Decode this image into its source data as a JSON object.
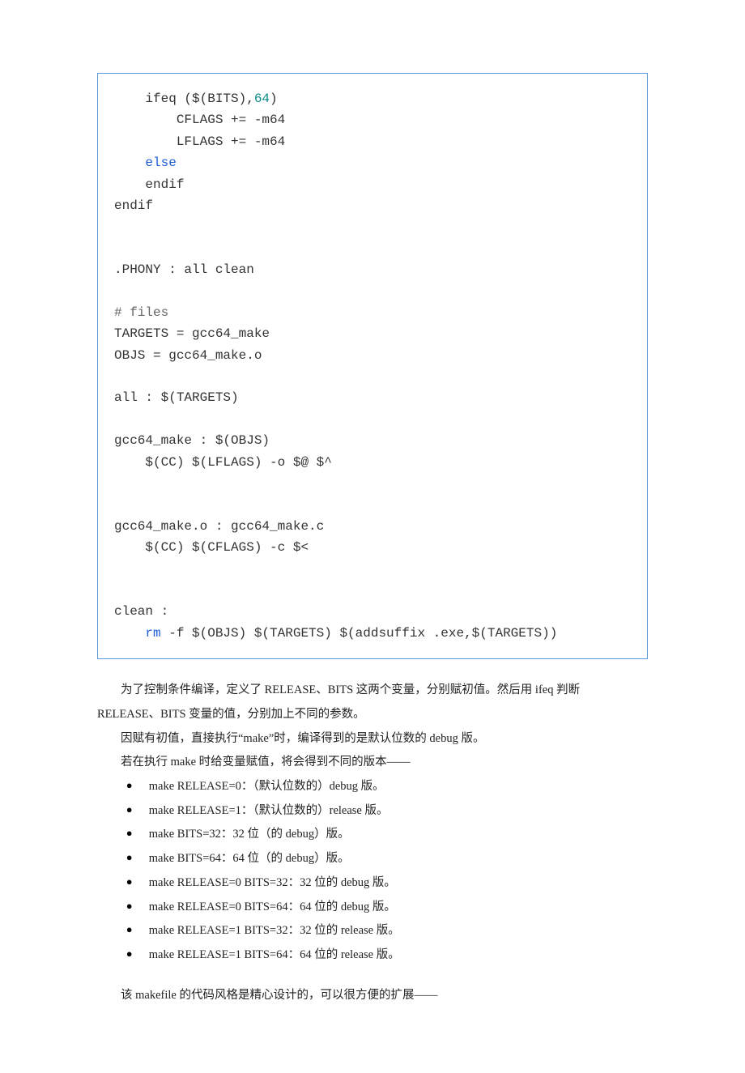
{
  "code": {
    "line01a": "    ifeq ($(BITS),",
    "line01b": "64",
    "line01c": ")",
    "line02": "        CFLAGS += -m64",
    "line03": "        LFLAGS += -m64",
    "line04": "    else",
    "line05": "    endif",
    "line06": "endif",
    "line07": "",
    "line08": "",
    "line09": ".PHONY : all clean",
    "line10": "",
    "line11": "# files",
    "line12": "TARGETS = gcc64_make",
    "line13": "OBJS = gcc64_make.o",
    "line14": "",
    "line15": "all : $(TARGETS)",
    "line16": "",
    "line17": "gcc64_make : $(OBJS)",
    "line18": "    $(CC) $(LFLAGS) -o $@ $^",
    "line19": "",
    "line20": "",
    "line21": "gcc64_make.o : gcc64_make.c",
    "line22": "    $(CC) $(CFLAGS) -c $<",
    "line23": "",
    "line24": "",
    "line25": "clean :",
    "line26a": "    ",
    "line26b": "rm",
    "line26c": " -f $(OBJS) $(TARGETS) $(addsuffix .exe,$(TARGETS))"
  },
  "paragraphs": {
    "p1": "为了控制条件编译，定义了 RELEASE、BITS 这两个变量，分别赋初值。然后用 ifeq 判断 RELEASE、BITS 变量的值，分别加上不同的参数。",
    "p2": "因赋有初值，直接执行“make”时，编译得到的是默认位数的 debug 版。",
    "p3": "若在执行 make 时给变量赋值，将会得到不同的版本——",
    "p4": "该 makefile 的代码风格是精心设计的，可以很方便的扩展——"
  },
  "bullets": [
    "make RELEASE=0：（默认位数的）debug 版。",
    "make RELEASE=1：（默认位数的）release 版。",
    "make BITS=32：32 位（的 debug）版。",
    "make BITS=64：64 位（的 debug）版。",
    "make RELEASE=0 BITS=32：32 位的 debug 版。",
    "make RELEASE=0 BITS=64：64 位的 debug 版。",
    "make RELEASE=1 BITS=32：32 位的 release 版。",
    "make RELEASE=1 BITS=64：64 位的 release 版。"
  ]
}
